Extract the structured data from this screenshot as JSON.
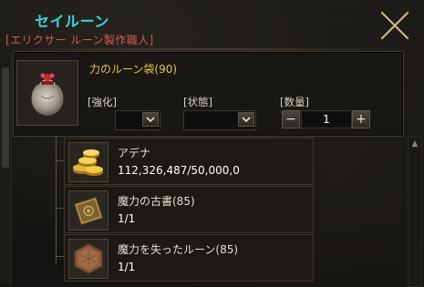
{
  "window": {
    "title": "セイルーン",
    "subtitle": "[エリクサー ルーン製作職人]"
  },
  "craft": {
    "item_name": "力のルーン袋(90)",
    "labels": {
      "enhance": "[強化]",
      "state": "[状態]",
      "quantity": "[数量]"
    },
    "enhance_value": "",
    "state_value": "",
    "quantity_value": "1",
    "minus": "−",
    "plus": "+"
  },
  "materials": [
    {
      "name": "アデナ",
      "count": "112,326,487/50,000,0",
      "icon": "adena-coins-icon"
    },
    {
      "name": "魔力の古書(85)",
      "count": "1/1",
      "icon": "ancient-book-icon"
    },
    {
      "name": "魔力を失ったルーン(85)",
      "count": "1/1",
      "icon": "drained-rune-icon"
    }
  ],
  "colors": {
    "title": "#35d6de",
    "subtitle": "#d45a4a",
    "item_name": "#e8c547"
  }
}
